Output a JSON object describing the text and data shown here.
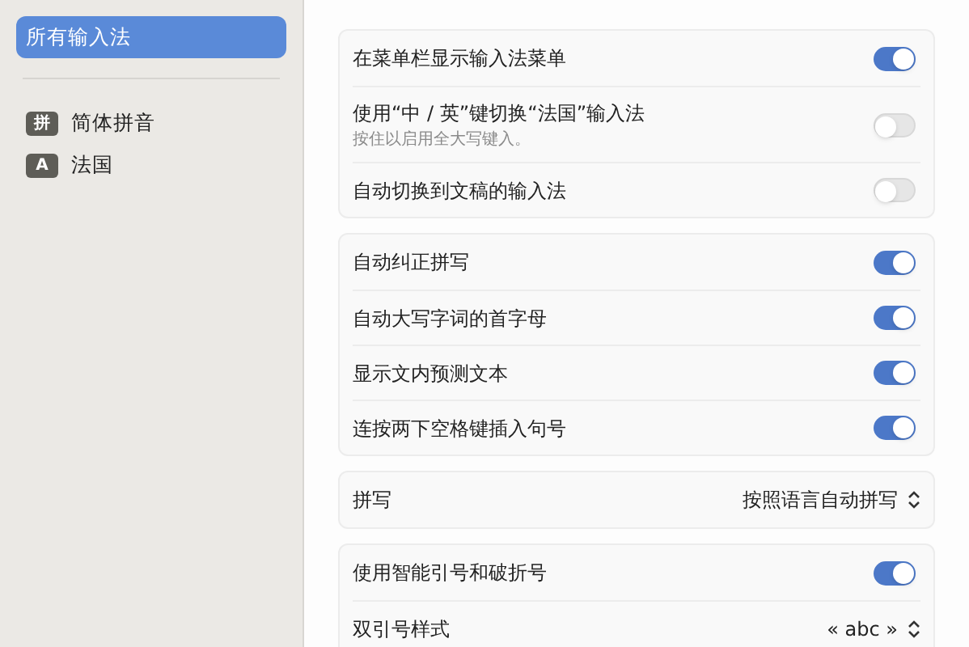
{
  "sidebar": {
    "items": [
      {
        "label": "所有输入法",
        "selected": true
      },
      {
        "label": "简体拼音",
        "badge": "拼",
        "selected": false
      },
      {
        "label": "法国",
        "badge": "A",
        "selected": false
      }
    ]
  },
  "groups": [
    {
      "rows": [
        {
          "kind": "toggle",
          "label": "在菜单栏显示输入法菜单",
          "on": true
        },
        {
          "kind": "toggle",
          "label": "使用“中 / 英”键切换“法国”输入法",
          "hint": "按住以启用全大写键入。",
          "on": false
        },
        {
          "kind": "toggle",
          "label": "自动切换到文稿的输入法",
          "on": false
        }
      ]
    },
    {
      "rows": [
        {
          "kind": "toggle",
          "label": "自动纠正拼写",
          "on": true
        },
        {
          "kind": "toggle",
          "label": "自动大写字词的首字母",
          "on": true
        },
        {
          "kind": "toggle",
          "label": "显示文内预测文本",
          "on": true
        },
        {
          "kind": "toggle",
          "label": "连按两下空格键插入句号",
          "on": true
        }
      ]
    },
    {
      "rows": [
        {
          "kind": "popup",
          "label": "拼写",
          "value": "按照语言自动拼写"
        }
      ]
    },
    {
      "rows": [
        {
          "kind": "toggle",
          "label": "使用智能引号和破折号",
          "on": true
        },
        {
          "kind": "popup",
          "label": "双引号样式",
          "value": "« abc »"
        }
      ]
    }
  ]
}
